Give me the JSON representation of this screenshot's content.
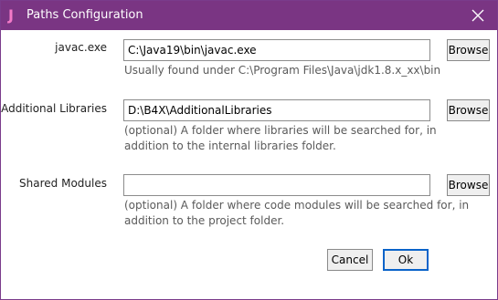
{
  "window": {
    "title": "Paths Configuration",
    "accent": "#7a3583",
    "icon": "b4x-j-icon",
    "close_icon": "close-icon"
  },
  "fields": [
    {
      "label": "javac.exe",
      "value": "C:\\Java19\\bin\\javac.exe",
      "button": "Browse",
      "hint_lines": [
        "Usually found under C:\\Program Files\\Java\\jdk1.8.x_xx\\bin"
      ]
    },
    {
      "label": "Additional Libraries",
      "value": "D:\\B4X\\AdditionalLibraries",
      "button": "Browse",
      "hint_lines": [
        "(optional) A folder where libraries will be searched for, in",
        "addition to the internal libraries folder."
      ]
    },
    {
      "label": "Shared Modules",
      "value": "",
      "button": "Browse",
      "hint_lines": [
        "(optional) A folder where code modules will be searched for, in",
        "addition to the project folder."
      ]
    }
  ],
  "footer": {
    "cancel_label": "Cancel",
    "ok_label": "Ok"
  }
}
